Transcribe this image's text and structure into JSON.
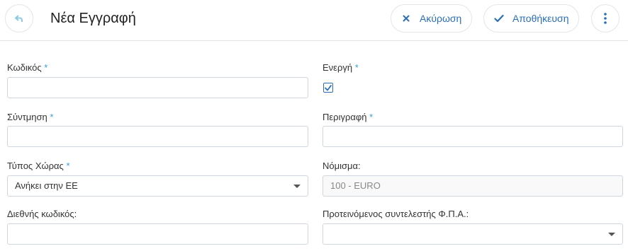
{
  "header": {
    "title": "Νέα Εγγραφή",
    "back_icon": "back-arrow-icon",
    "cancel_label": "Ακύρωση",
    "save_label": "Αποθήκευση",
    "more_icon": "more-vertical-icon"
  },
  "colors": {
    "accent": "#2a6fb8",
    "required_star": "#3aa0d8",
    "border": "#cfd6de"
  },
  "form": {
    "code": {
      "label": "Κωδικός",
      "required": "*",
      "value": ""
    },
    "active": {
      "label": "Ενεργή",
      "required": "*",
      "checked": true
    },
    "abbreviation": {
      "label": "Σύντμηση",
      "required": "*",
      "value": ""
    },
    "description": {
      "label": "Περιγραφή",
      "required": "*",
      "value": ""
    },
    "country_type": {
      "label": "Τύπος Χώρας",
      "required": "*",
      "value": "Ανήκει στην ΕΕ"
    },
    "currency": {
      "label": "Νόμισμα:",
      "value": "100 - EURO"
    },
    "intl_code": {
      "label": "Διεθνής κωδικός:",
      "value": ""
    },
    "vat_rate": {
      "label": "Προτεινόμενος συντελεστής Φ.Π.Α.:",
      "value": ""
    }
  }
}
